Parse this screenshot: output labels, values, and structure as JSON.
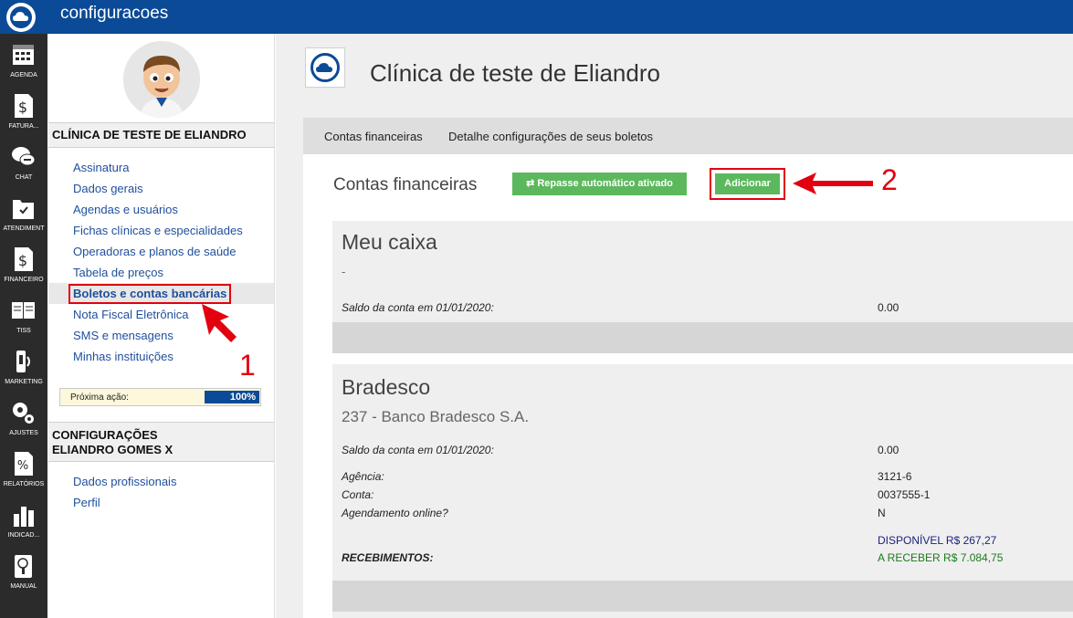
{
  "topbar": {
    "title": "configuracoes"
  },
  "leftnav": {
    "items": [
      {
        "label": "AGENDA",
        "icon": "calendar-icon"
      },
      {
        "label": "FATURA...",
        "icon": "dollar-document-icon"
      },
      {
        "label": "CHAT",
        "icon": "chat-icon"
      },
      {
        "label": "ATENDIMENT",
        "icon": "folder-check-icon"
      },
      {
        "label": "FINANCEIRO",
        "icon": "dollar-icon"
      },
      {
        "label": "TISS",
        "icon": "book-icon"
      },
      {
        "label": "MARKETING",
        "icon": "phone-icon"
      },
      {
        "label": "AJUSTES",
        "icon": "gears-icon"
      },
      {
        "label": "RELATÓRIOS",
        "icon": "percent-icon"
      },
      {
        "label": "INDICAD...",
        "icon": "bar-chart-icon"
      },
      {
        "label": "MANUAL",
        "icon": "manual-icon"
      }
    ]
  },
  "sidebar": {
    "clinic_section": "CLÍNICA DE TESTE DE ELIANDRO",
    "clinic_menu": [
      "Assinatura",
      "Dados gerais",
      "Agendas e usuários",
      "Fichas clínicas e especialidades",
      "Operadoras e planos de saúde",
      "Tabela de preços",
      "Boletos e contas bancárias",
      "Nota Fiscal Eletrônica",
      "SMS e mensagens",
      "Minhas instituições"
    ],
    "next_action": {
      "label": "Próxima ação:",
      "value": "100%",
      "progress": 1.0
    },
    "user_section_line1": "CONFIGURAÇÕES",
    "user_section_line2": "ELIANDRO GOMES X",
    "user_menu": [
      "Dados profissionais",
      "Perfil"
    ]
  },
  "main": {
    "clinic_title": "Clínica de teste de Eliandro",
    "tabs": [
      "Contas financeiras",
      "Detalhe configurações de seus boletos"
    ],
    "content_title": "Contas financeiras",
    "repasse_button": "⇄ Repasse automático ativado",
    "add_button": "Adicionar",
    "annotation_1": "1",
    "annotation_2": "2",
    "accounts": [
      {
        "name": "Meu caixa",
        "subtitle": "-",
        "balance_label": "Saldo da conta em 01/01/2020:",
        "balance_value": "0.00"
      },
      {
        "name": "Bradesco",
        "subtitle": "237 - Banco Bradesco S.A.",
        "balance_label": "Saldo da conta em 01/01/2020:",
        "balance_value": "0.00",
        "agencia_label": "Agência:",
        "agencia_value": "3121-6",
        "conta_label": "Conta:",
        "conta_value": "0037555-1",
        "online_label": "Agendamento online?",
        "online_value": "N",
        "receb_label": "RECEBIMENTOS:",
        "disponivel": "DISPONÍVEL R$ 267,27",
        "a_receber": "A RECEBER R$ 7.084,75"
      }
    ]
  },
  "colors": {
    "brand_blue": "#0b4a96",
    "button_green": "#5cb85c",
    "annotation_red": "#e3000f",
    "link_blue": "#1f4f9c"
  }
}
